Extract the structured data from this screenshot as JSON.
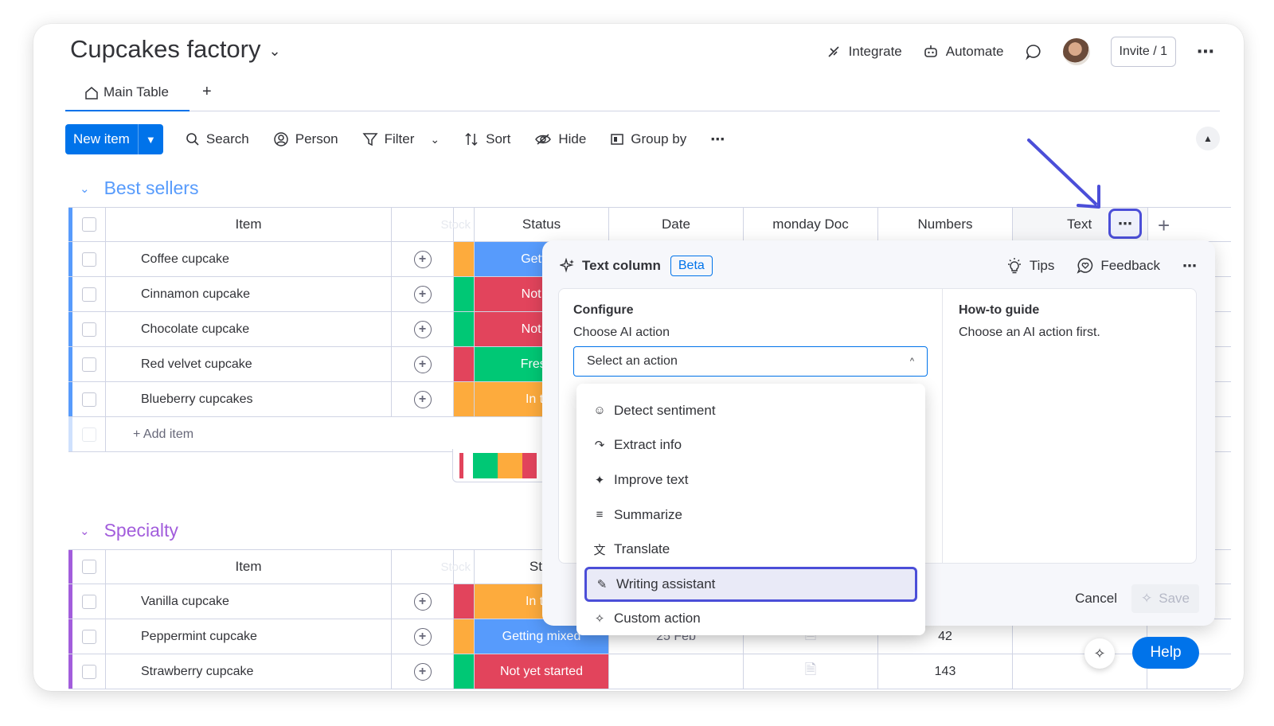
{
  "board": {
    "title": "Cupcakes factory"
  },
  "header": {
    "integrate": "Integrate",
    "automate": "Automate",
    "invite": "Invite / 1"
  },
  "tabs": {
    "main": "Main Table",
    "add": "+"
  },
  "toolbar": {
    "new_item": "New item",
    "search": "Search",
    "person": "Person",
    "filter": "Filter",
    "sort": "Sort",
    "hide": "Hide",
    "group_by": "Group by"
  },
  "columns": {
    "item": "Item",
    "stock": "Stock",
    "status": "Status",
    "status_cut": "Stat",
    "date": "Date",
    "doc": "monday Doc",
    "numbers": "Numbers",
    "text": "Text"
  },
  "groups": [
    {
      "title": "Best sellers",
      "color": "#579bfc",
      "add_item": "+ Add item",
      "rows": [
        {
          "name": "Coffee cupcake",
          "stock_color": "#fdab3d",
          "status": "Getting",
          "status_color": "#579bfc"
        },
        {
          "name": "Cinnamon cupcake",
          "stock_color": "#00c875",
          "status": "Not yet",
          "status_color": "#e2445c"
        },
        {
          "name": "Chocolate cupcake",
          "stock_color": "#00c875",
          "status": "Not yet",
          "status_color": "#e2445c"
        },
        {
          "name": "Red velvet cupcake",
          "stock_color": "#e2445c",
          "status": "Freshly",
          "status_color": "#00c875"
        },
        {
          "name": "Blueberry cupcakes",
          "stock_color": "#fdab3d",
          "status": "In the",
          "status_color": "#fdab3d"
        }
      ]
    },
    {
      "title": "Specialty",
      "color": "#a25ddc",
      "rows": [
        {
          "name": "Vanilla cupcake",
          "stock_color": "#e2445c",
          "status": "In the",
          "status_color": "#fdab3d",
          "date": "",
          "number": ""
        },
        {
          "name": "Peppermint cupcake",
          "stock_color": "#fdab3d",
          "status": "Getting mixed",
          "status_color": "#579bfc",
          "date": "25 Feb",
          "number": "42"
        },
        {
          "name": "Strawberry cupcake",
          "stock_color": "#00c875",
          "status": "Not yet started",
          "status_color": "#e2445c",
          "date": "",
          "number": "143"
        }
      ]
    }
  ],
  "panel": {
    "title": "Text column",
    "badge": "Beta",
    "tips": "Tips",
    "feedback": "Feedback",
    "configure": "Configure",
    "choose_label": "Choose AI action",
    "select_placeholder": "Select an action",
    "howto_title": "How-to guide",
    "howto_text": "Choose an AI action first.",
    "cancel": "Cancel",
    "save": "Save"
  },
  "ai_actions": [
    {
      "label": "Detect sentiment",
      "icon": "smile-icon"
    },
    {
      "label": "Extract info",
      "icon": "extract-arrow-icon"
    },
    {
      "label": "Improve text",
      "icon": "magic-wand-icon"
    },
    {
      "label": "Summarize",
      "icon": "summarize-icon"
    },
    {
      "label": "Translate",
      "icon": "translate-icon"
    },
    {
      "label": "Writing assistant",
      "icon": "pencil-icon",
      "highlighted": true
    },
    {
      "label": "Custom action",
      "icon": "sparkle-icon"
    }
  ],
  "help": "Help",
  "colors": {
    "primary": "#0073ea",
    "highlight": "#4b4ed8"
  }
}
